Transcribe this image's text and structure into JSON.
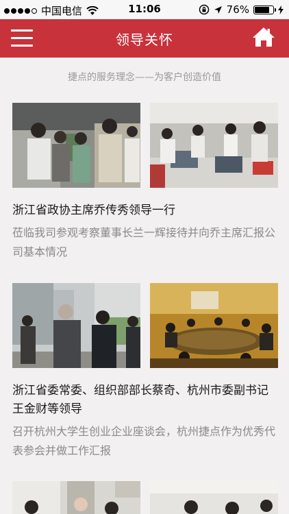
{
  "status_bar": {
    "carrier": "中国电信",
    "time": "11:06",
    "battery": "76%"
  },
  "nav": {
    "title": "领导关怀",
    "menu_icon": "menu-icon",
    "home_icon": "home-icon"
  },
  "slogan": "捷点的服务理念——为客户创造价值",
  "news": [
    {
      "title": "浙江省政协主席乔传秀领导一行",
      "desc": "莅临我司参观考察董事长兰一辉接待并向乔主席汇报公司基本情况"
    },
    {
      "title": "浙江省委常委、组织部部长蔡奇、杭州市委副书记王金财等领导",
      "desc": "召开杭州大学生创业企业座谈会，杭州捷点作为优秀代表参会并做工作汇报"
    }
  ],
  "colors": {
    "brand": "#c7323b",
    "background": "#f2f0f0"
  }
}
